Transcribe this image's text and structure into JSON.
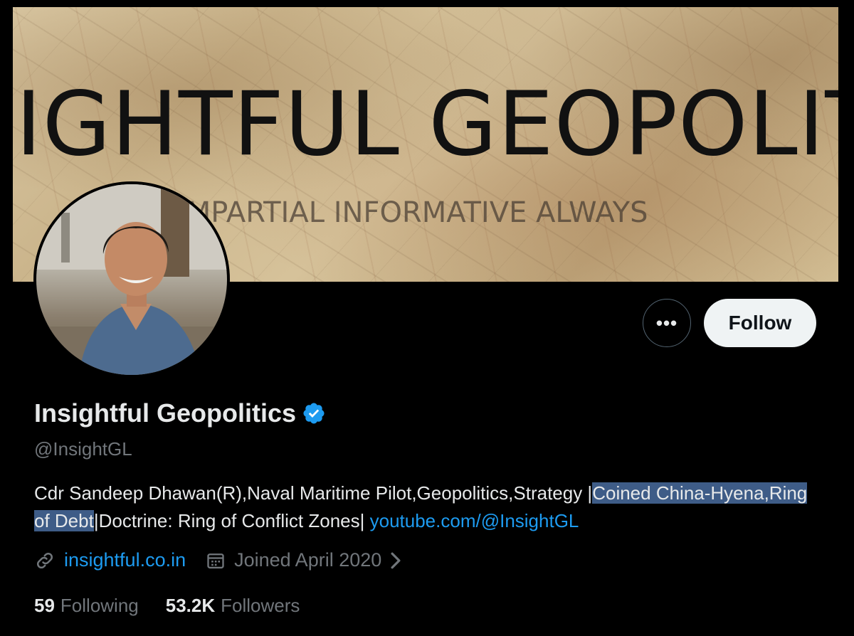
{
  "banner": {
    "title": "IGHTFUL GEOPOLITI",
    "tagline": "IMPARTIAL INFORMATIVE ALWAYS"
  },
  "actions": {
    "more_label": "•••",
    "follow_label": "Follow"
  },
  "profile": {
    "display_name": "Insightful Geopolitics",
    "handle": "@InsightGL",
    "verified_color": "#1d9bf0",
    "bio": {
      "part1": "Cdr Sandeep Dhawan(R),Naval Maritime Pilot,Geopolitics,Strategy |",
      "highlight": "Coined China-Hyena,Ring of Debt",
      "part2": "|Doctrine: Ring of Conflict Zones| ",
      "link": "youtube.com/@InsightGL"
    },
    "website": "insightful.co.in",
    "joined": "Joined April 2020"
  },
  "stats": {
    "following_count": "59",
    "following_label": "Following",
    "followers_count": "53.2K",
    "followers_label": "Followers"
  },
  "icons": {
    "link": "link-icon",
    "calendar": "calendar-icon",
    "chevron": "chevron-right-icon",
    "verified": "verified-badge-icon"
  }
}
